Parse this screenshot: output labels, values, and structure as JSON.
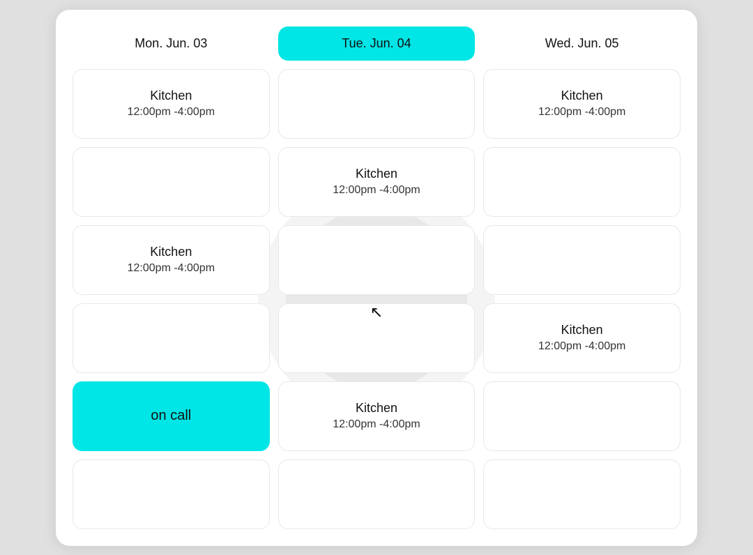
{
  "header": {
    "days": [
      {
        "id": "mon",
        "label": "Mon. Jun. 03",
        "today": false
      },
      {
        "id": "tue",
        "label": "Tue. Jun. 04",
        "today": true
      },
      {
        "id": "wed",
        "label": "Wed. Jun. 05",
        "today": false
      }
    ]
  },
  "rows": [
    {
      "cells": [
        {
          "type": "shift",
          "location": "Kitchen",
          "time": "12:00pm -4:00pm"
        },
        {
          "type": "empty"
        },
        {
          "type": "shift",
          "location": "Kitchen",
          "time": "12:00pm -4:00pm"
        }
      ]
    },
    {
      "cells": [
        {
          "type": "empty"
        },
        {
          "type": "shift",
          "location": "Kitchen",
          "time": "12:00pm -4:00pm"
        },
        {
          "type": "empty"
        }
      ]
    },
    {
      "cells": [
        {
          "type": "shift",
          "location": "Kitchen",
          "time": "12:00pm -4:00pm"
        },
        {
          "type": "empty"
        },
        {
          "type": "empty"
        }
      ]
    },
    {
      "cells": [
        {
          "type": "empty"
        },
        {
          "type": "empty"
        },
        {
          "type": "shift",
          "location": "Kitchen",
          "time": "12:00pm -4:00pm"
        }
      ]
    },
    {
      "cells": [
        {
          "type": "oncall",
          "label": "on call"
        },
        {
          "type": "shift",
          "location": "Kitchen",
          "time": "12:00pm -4:00pm"
        },
        {
          "type": "empty"
        }
      ]
    },
    {
      "cells": [
        {
          "type": "empty"
        },
        {
          "type": "empty"
        },
        {
          "type": "empty"
        }
      ]
    }
  ]
}
